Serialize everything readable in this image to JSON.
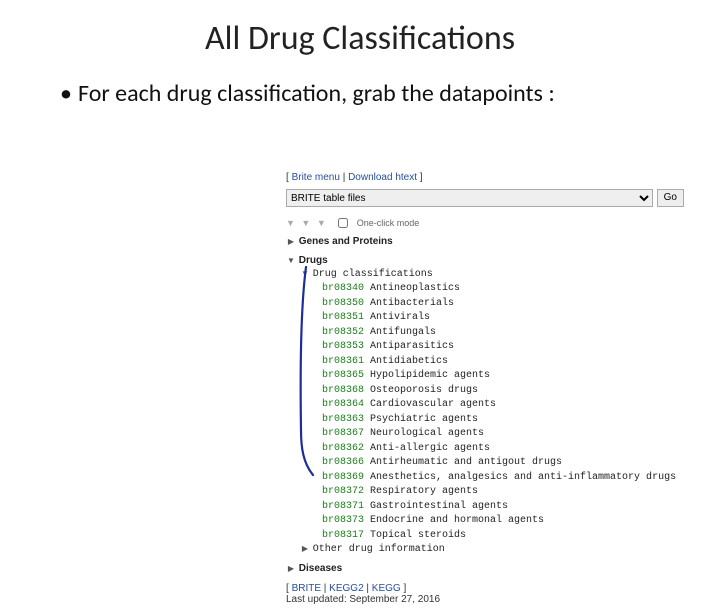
{
  "slide": {
    "title": "All Drug Classifications",
    "bullet": "For each drug classification, grab the datapoints :"
  },
  "nav": {
    "brite_menu": "Brite menu",
    "download": "Download htext",
    "select": "BRITE table files",
    "go": "Go"
  },
  "controls": {
    "one_click": "One-click mode"
  },
  "tree": {
    "genes": "Genes and Proteins",
    "drugs": "Drugs",
    "drug_class": "Drug classifications",
    "other_drug": "Other drug information",
    "diseases": "Diseases",
    "items": [
      {
        "code": "br08340",
        "label": "Antineoplastics"
      },
      {
        "code": "br08350",
        "label": "Antibacterials"
      },
      {
        "code": "br08351",
        "label": "Antivirals"
      },
      {
        "code": "br08352",
        "label": "Antifungals"
      },
      {
        "code": "br08353",
        "label": "Antiparasitics"
      },
      {
        "code": "br08361",
        "label": "Antidiabetics"
      },
      {
        "code": "br08365",
        "label": "Hypolipidemic agents"
      },
      {
        "code": "br08368",
        "label": "Osteoporosis drugs"
      },
      {
        "code": "br08364",
        "label": "Cardiovascular agents"
      },
      {
        "code": "br08363",
        "label": "Psychiatric agents"
      },
      {
        "code": "br08367",
        "label": "Neurological agents"
      },
      {
        "code": "br08362",
        "label": "Anti-allergic agents"
      },
      {
        "code": "br08366",
        "label": "Antirheumatic and antigout drugs"
      },
      {
        "code": "br08369",
        "label": "Anesthetics, analgesics and anti-inflammatory drugs"
      },
      {
        "code": "br08372",
        "label": "Respiratory agents"
      },
      {
        "code": "br08371",
        "label": "Gastrointestinal agents"
      },
      {
        "code": "br08373",
        "label": "Endocrine and hormonal agents"
      },
      {
        "code": "br08317",
        "label": "Topical steroids"
      }
    ]
  },
  "footer": {
    "brite": "BRITE",
    "kegg2": "KEGG2",
    "kegg": "KEGG",
    "updated": "Last updated: September 27, 2016"
  }
}
